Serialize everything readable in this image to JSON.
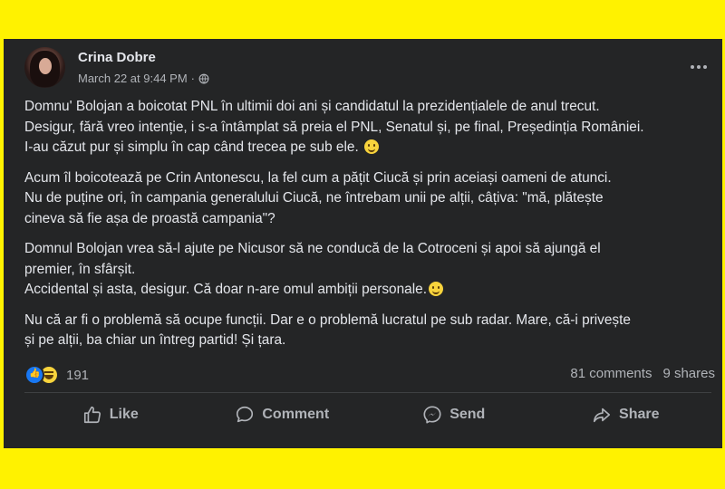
{
  "post": {
    "author": "Crina Dobre",
    "timestamp": "March 22 at 9:44 PM",
    "separator": "·",
    "privacy_icon": "globe-icon",
    "more_icon": "more-options-icon",
    "paragraphs": [
      {
        "lines": [
          "Domnu' Bolojan a boicotat PNL în ultimii doi ani și candidatul la prezidențialele de anul trecut.",
          "Desigur, fără vreo intenție, i s-a întâmplat să preia el PNL, Senatul și, pe final, Președinția României.",
          "I-au căzut pur și simplu în cap când trecea pe sub ele."
        ],
        "emoji": "smile-emoji"
      },
      {
        "lines": [
          "Acum îl boicotează pe Crin Antonescu, la fel cum a pățit Ciucă și prin aceiași oameni de atunci.",
          "Nu de puține ori, în campania generalului Ciucă, ne întrebam unii pe alții, câțiva: \"mă, plătește",
          "cineva să fie așa de proastă campania\"?"
        ]
      },
      {
        "lines": [
          "Domnul Bolojan vrea să-l ajute pe Nicusor să ne conducă de la Cotroceni și apoi să ajungă el",
          "premier, în sfârșit.",
          "Accidental și asta, desigur. Că doar n-are omul ambiții personale."
        ],
        "emoji": "smile-emoji"
      },
      {
        "lines": [
          "Nu că ar fi o problemă să ocupe funcții. Dar e o problemă lucratul pe sub radar. Mare, că-i privește",
          "și pe alții, ba chiar un întreg partid! Și țara."
        ]
      }
    ],
    "reactions": {
      "types": [
        "like",
        "haha"
      ],
      "count": "191"
    },
    "comments_count": "81 comments",
    "shares_count": "9 shares",
    "actions": {
      "like": "Like",
      "comment": "Comment",
      "send": "Send",
      "share": "Share"
    }
  },
  "colors": {
    "background": "#fff200",
    "card": "#242526",
    "text": "#e4e6eb",
    "secondary_text": "#b0b3b8"
  }
}
